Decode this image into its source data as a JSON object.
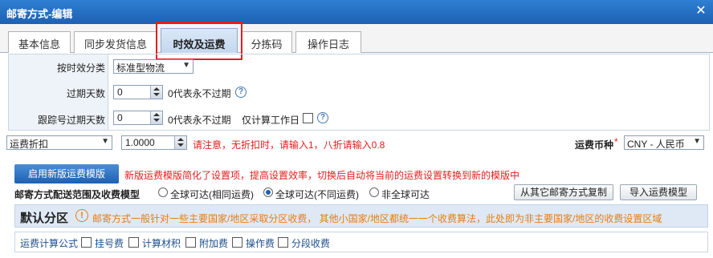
{
  "window": {
    "title": "邮寄方式-编辑",
    "close_icon": "close-icon"
  },
  "tabs": [
    {
      "label": "基本信息",
      "active": false
    },
    {
      "label": "同步发货信息",
      "active": false
    },
    {
      "label": "时效及运费",
      "active": true
    },
    {
      "label": "分拣码",
      "active": false
    },
    {
      "label": "操作日志",
      "active": false
    }
  ],
  "form": {
    "timeliness": {
      "label": "按时效分类",
      "value": "标准型物流"
    },
    "expire_days": {
      "label": "过期天数",
      "value": "0",
      "hint": "0代表永不过期"
    },
    "tracking_expire_days": {
      "label": "跟踪号过期天数",
      "value": "0",
      "hint": "0代表永不过期",
      "workday_label": "仅计算工作日",
      "workday_checked": false
    }
  },
  "discount": {
    "select_value": "运费折扣",
    "input_value": "1.0000",
    "note": "请注意，无折扣时，请输入1，八折请输入0.8",
    "currency_label": "运费币种",
    "currency_required": "*",
    "currency_value": "CNY - 人民币"
  },
  "new_template": {
    "button_label": "启用新版运费模版",
    "notice": "新版运费模版简化了设置项，提高设置效率，切换后自动将当前的运费设置转换到新的模版中"
  },
  "scope": {
    "label": "邮寄方式配送范围及收费模型",
    "options": [
      {
        "label": "全球可达(相同运费)",
        "checked": false
      },
      {
        "label": "全球可达(不同运费)",
        "checked": true
      },
      {
        "label": "非全球可达",
        "checked": false
      }
    ],
    "copy_button": "从其它邮寄方式复制",
    "import_button": "导入运费模型"
  },
  "region": {
    "title": "默认分区",
    "note": "邮寄方式一般针对一些主要国家/地区采取分区收费， 其他小国家/地区都统一一个收费算法，此处即为非主要国家/地区的收费设置区域"
  },
  "fee_options": {
    "label": "运费计算公式",
    "items": [
      {
        "label": "挂号费",
        "checked": false
      },
      {
        "label": "计算材积",
        "checked": false
      },
      {
        "label": "附加费",
        "checked": false
      },
      {
        "label": "操作费",
        "checked": false
      },
      {
        "label": "分段收费",
        "checked": false
      }
    ]
  },
  "colors": {
    "accent": "#1f60b1",
    "warning": "#e0201e",
    "note": "#e67d12"
  }
}
